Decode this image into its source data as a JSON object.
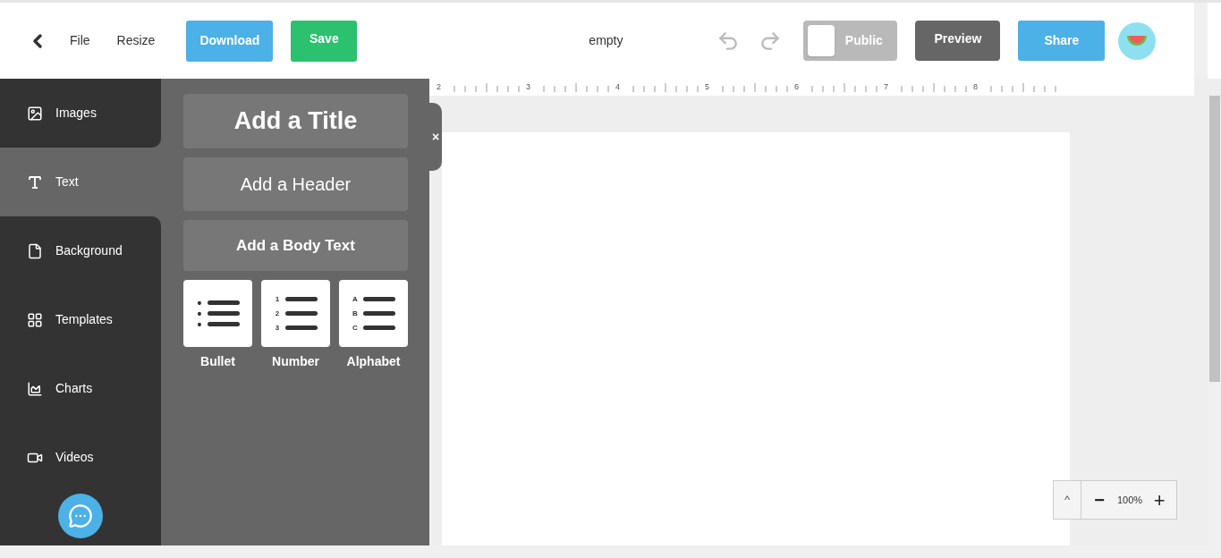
{
  "toolbar": {
    "menu": [
      "File",
      "Resize"
    ],
    "download": "Download",
    "save": "Save",
    "document_title": "empty",
    "public": {
      "label": "Public",
      "on": false
    },
    "preview": "Preview",
    "share": "Share"
  },
  "sidebar": {
    "items": [
      {
        "kind": "image",
        "label": "Images",
        "selected": false
      },
      {
        "kind": "text",
        "label": "Text",
        "selected": true
      },
      {
        "kind": "page",
        "label": "Background",
        "selected": false
      },
      {
        "kind": "grid",
        "label": "Templates",
        "selected": false
      },
      {
        "kind": "chart",
        "label": "Charts",
        "selected": false
      },
      {
        "kind": "video",
        "label": "Videos",
        "selected": false
      }
    ]
  },
  "text_panel": {
    "close": "×",
    "styles": [
      {
        "kind": "title",
        "label": "Add a Title"
      },
      {
        "kind": "header",
        "label": "Add a Header"
      },
      {
        "kind": "body",
        "label": "Add a Body Text"
      }
    ],
    "lists": [
      {
        "label": "Bullet",
        "markers": [
          "•",
          "•",
          "•"
        ]
      },
      {
        "label": "Number",
        "markers": [
          "1",
          "2",
          "3"
        ]
      },
      {
        "label": "Alphabet",
        "markers": [
          "A",
          "B",
          "C"
        ]
      }
    ]
  },
  "ruler": [
    "2",
    "3",
    "4",
    "5",
    "6",
    "7",
    "8"
  ],
  "zoom": {
    "up": "^",
    "minus": "−",
    "value": "100%",
    "plus": "+"
  }
}
